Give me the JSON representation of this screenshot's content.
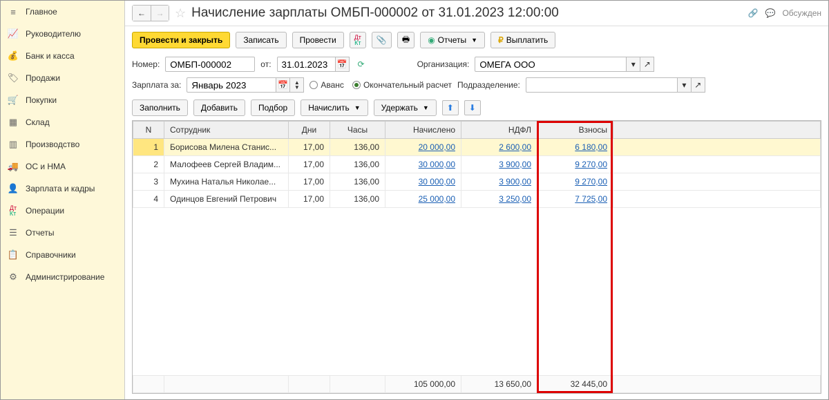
{
  "sidebar": {
    "items": [
      {
        "label": "Главное",
        "icon": "≡"
      },
      {
        "label": "Руководителю",
        "icon": "📈"
      },
      {
        "label": "Банк и касса",
        "icon": "💰"
      },
      {
        "label": "Продажи",
        "icon": "🏷"
      },
      {
        "label": "Покупки",
        "icon": "🛒"
      },
      {
        "label": "Склад",
        "icon": "▦"
      },
      {
        "label": "Производство",
        "icon": "▥"
      },
      {
        "label": "ОС и НМА",
        "icon": "🚚"
      },
      {
        "label": "Зарплата и кадры",
        "icon": "👤"
      },
      {
        "label": "Операции",
        "icon": ""
      },
      {
        "label": "Отчеты",
        "icon": "☰"
      },
      {
        "label": "Справочники",
        "icon": "📋"
      },
      {
        "label": "Администрирование",
        "icon": "⚙"
      }
    ]
  },
  "header": {
    "title": "Начисление зарплаты ОМБП-000002 от 31.01.2023 12:00:00",
    "discuss": "Обсужден"
  },
  "toolbar": {
    "primary": "Провести и закрыть",
    "write": "Записать",
    "post": "Провести",
    "reports": "Отчеты",
    "pay": "Выплатить"
  },
  "form": {
    "number_label": "Номер:",
    "number_value": "ОМБП-000002",
    "from_label": "от:",
    "date_value": "31.01.2023",
    "org_label": "Организация:",
    "org_value": "ОМЕГА ООО",
    "salary_for_label": "Зарплата за:",
    "salary_for_value": "Январь 2023",
    "advance": "Аванс",
    "final": "Окончательный расчет",
    "dept_label": "Подразделение:",
    "dept_value": ""
  },
  "toolbar2": {
    "fill": "Заполнить",
    "add": "Добавить",
    "pick": "Подбор",
    "accrue": "Начислить",
    "deduct": "Удержать"
  },
  "table": {
    "headers": {
      "n": "N",
      "emp": "Сотрудник",
      "days": "Дни",
      "hours": "Часы",
      "accrued": "Начислено",
      "ndfl": "НДФЛ",
      "contrib": "Взносы"
    },
    "rows": [
      {
        "n": "1",
        "emp": "Борисова Милена Станис...",
        "days": "17,00",
        "hours": "136,00",
        "accrued": "20 000,00",
        "ndfl": "2 600,00",
        "contrib": "6 180,00"
      },
      {
        "n": "2",
        "emp": "Малофеев Сергей Владим...",
        "days": "17,00",
        "hours": "136,00",
        "accrued": "30 000,00",
        "ndfl": "3 900,00",
        "contrib": "9 270,00"
      },
      {
        "n": "3",
        "emp": "Мухина Наталья Николае...",
        "days": "17,00",
        "hours": "136,00",
        "accrued": "30 000,00",
        "ndfl": "3 900,00",
        "contrib": "9 270,00"
      },
      {
        "n": "4",
        "emp": "Одинцов Евгений Петрович",
        "days": "17,00",
        "hours": "136,00",
        "accrued": "25 000,00",
        "ndfl": "3 250,00",
        "contrib": "7 725,00"
      }
    ],
    "totals": {
      "accrued": "105 000,00",
      "ndfl": "13 650,00",
      "contrib": "32 445,00"
    }
  }
}
